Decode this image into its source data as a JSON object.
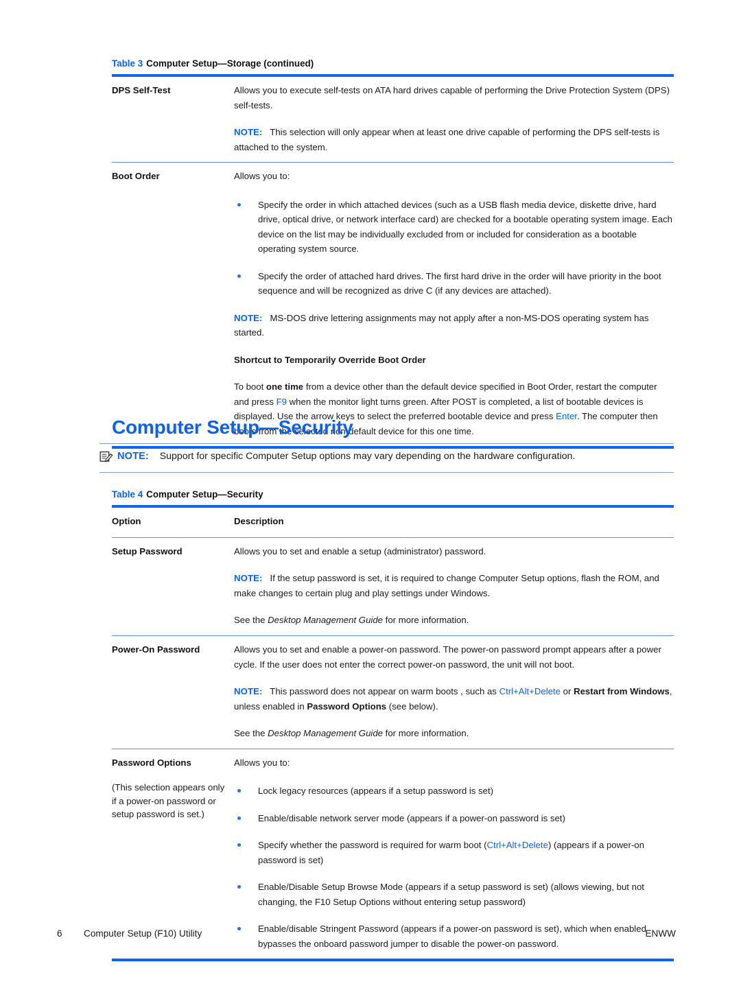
{
  "colors": {
    "accent_blue": "#0a62f0",
    "rule_thick": "#0a66f2",
    "rule_thin": "#5a8fd8",
    "text": "#1a1a1a"
  },
  "table3": {
    "caption_number": "Table 3",
    "caption_text": "Computer Setup—Storage (continued)",
    "rows": [
      {
        "option": "DPS Self-Test",
        "paragraphs": [
          {
            "kind": "text",
            "text": "Allows you to execute self-tests on ATA hard drives capable of performing the Drive Protection System (DPS) self-tests."
          },
          {
            "kind": "note",
            "label": "NOTE:",
            "text": "This selection will only appear when at least one drive capable of performing the DPS self-tests is attached to the system."
          }
        ]
      },
      {
        "option": "Boot Order",
        "paragraphs": [
          {
            "kind": "text",
            "text": "Allows you to:"
          },
          {
            "kind": "bullets",
            "items": [
              "Specify the order in which attached devices (such as a USB flash media device, diskette drive, hard drive, optical drive, or network interface card) are checked for a bootable operating system image. Each device on the list may be individually excluded from or included for consideration as a bootable operating system source.",
              "Specify the order of attached hard drives. The first hard drive in the order will have priority in the boot sequence and will be recognized as drive C (if any devices are attached)."
            ]
          },
          {
            "kind": "note",
            "label": "NOTE:",
            "text": "MS-DOS drive lettering assignments may not apply after a non-MS-DOS operating system has started."
          },
          {
            "kind": "subhead",
            "text": "Shortcut to Temporarily Override Boot Order"
          },
          {
            "kind": "rich_shortcut",
            "part1": "To boot ",
            "bold1": "one time",
            "part2": " from a device other than the default device specified in Boot Order, restart the computer and press ",
            "key1": "F9",
            "part3": " when the monitor light turns green. After POST is completed, a list of bootable devices is displayed. Use the arrow keys to select the preferred bootable device and press ",
            "key2": "Enter",
            "part4": ". The computer then boots from the selected non-default device for this one time."
          }
        ]
      }
    ]
  },
  "section": {
    "heading": "Computer Setup—Security"
  },
  "note_block": {
    "icon": "note-pencil-icon",
    "label": "NOTE:",
    "text": "Support for specific Computer Setup options may vary depending on the hardware configuration."
  },
  "table4": {
    "caption_number": "Table 4",
    "caption_text": "Computer Setup—Security",
    "headers": {
      "option": "Option",
      "description": "Description"
    },
    "rows": [
      {
        "option": "Setup Password",
        "option_sub": "",
        "paragraphs": [
          {
            "kind": "text",
            "text": "Allows you to set and enable a setup (administrator) password."
          },
          {
            "kind": "note",
            "label": "NOTE:",
            "text": "If the setup password is set, it is required to change Computer Setup options, flash the ROM, and make changes to certain plug and play settings under Windows."
          },
          {
            "kind": "see_guide",
            "pre": "See the ",
            "guide": "Desktop Management Guide",
            "post": " for more information."
          }
        ]
      },
      {
        "option": "Power-On Password",
        "option_sub": "",
        "paragraphs": [
          {
            "kind": "text",
            "text": "Allows you to set and enable a power-on password. The power-on password prompt appears after a power cycle. If the user does not enter the correct power-on password, the unit will not boot."
          },
          {
            "kind": "rich_note_warm",
            "label": "NOTE:",
            "p1": "This password does not appear on warm boots , such as ",
            "k1": "Ctrl",
            "plus1": "+",
            "k2": "Alt",
            "plus2": "+",
            "k3": "Delete",
            "p2": " or ",
            "b1": "Restart from Windows",
            "p3": ", unless enabled in ",
            "b2": "Password Options",
            "p4": " (see below)."
          },
          {
            "kind": "see_guide",
            "pre": "See the ",
            "guide": "Desktop Management Guide",
            "post": " for more information."
          }
        ]
      },
      {
        "option": "Password Options",
        "option_sub": "(This selection appears only if a power-on password or setup password is set.)",
        "paragraphs": [
          {
            "kind": "text",
            "text": "Allows you to:"
          },
          {
            "kind": "bullets_mixed",
            "items": [
              {
                "type": "plain",
                "text": "Lock legacy resources (appears if a setup password is set)"
              },
              {
                "type": "plain",
                "text": "Enable/disable network server mode (appears if a power-on password is set)"
              },
              {
                "type": "keys",
                "p1": "Specify whether the password is required for warm boot (",
                "k1": "Ctrl",
                "plus1": "+",
                "k2": "Alt",
                "plus2": "+",
                "k3": "Delete",
                "p2": ") (appears if a power-on password is set)"
              },
              {
                "type": "plain",
                "text": "Enable/Disable Setup Browse Mode (appears if a setup password is set) (allows viewing, but not changing, the F10 Setup Options without entering setup password)"
              },
              {
                "type": "plain",
                "text": "Enable/disable Stringent Password (appears if a power-on password is set), which when enabled bypasses the onboard password jumper to disable the power-on password."
              }
            ]
          }
        ]
      }
    ]
  },
  "footer": {
    "page_number": "6",
    "title": "Computer Setup (F10) Utility",
    "locale": "ENWW"
  }
}
